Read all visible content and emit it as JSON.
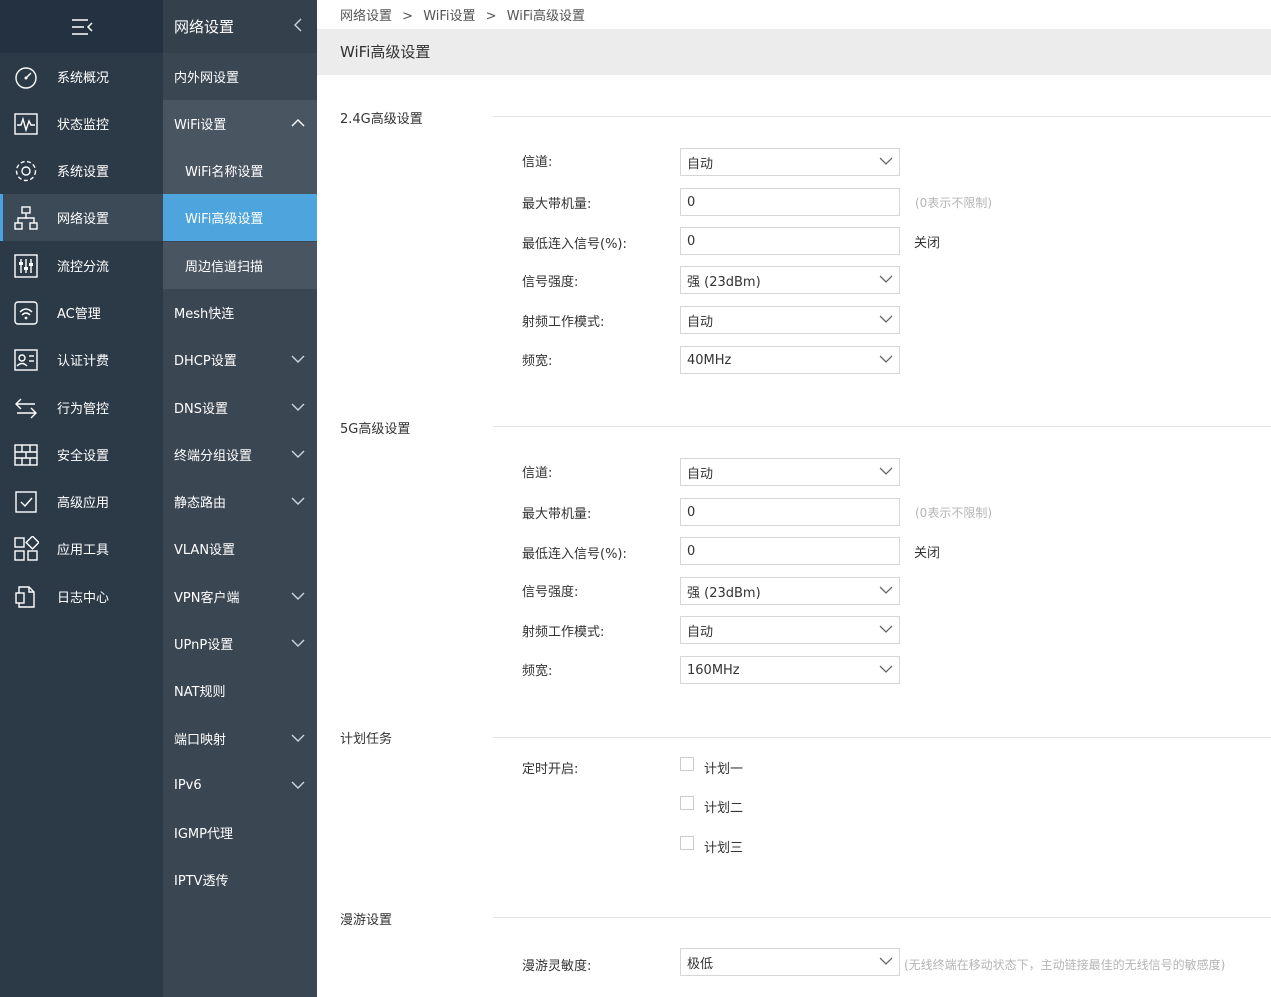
{
  "nav1": {
    "items": [
      {
        "label": "系统概况",
        "icon": "dashboard-icon"
      },
      {
        "label": "状态监控",
        "icon": "monitor-icon"
      },
      {
        "label": "系统设置",
        "icon": "gear-icon"
      },
      {
        "label": "网络设置",
        "icon": "network-icon"
      },
      {
        "label": "流控分流",
        "icon": "sliders-icon"
      },
      {
        "label": "AC管理",
        "icon": "ap-icon"
      },
      {
        "label": "认证计费",
        "icon": "id-card-icon"
      },
      {
        "label": "行为管控",
        "icon": "arrows-icon"
      },
      {
        "label": "安全设置",
        "icon": "firewall-icon"
      },
      {
        "label": "高级应用",
        "icon": "checklist-icon"
      },
      {
        "label": "应用工具",
        "icon": "apps-icon"
      },
      {
        "label": "日志中心",
        "icon": "document-icon"
      }
    ]
  },
  "nav2": {
    "title": "网络设置",
    "items": [
      {
        "label": "内外网设置"
      },
      {
        "label": "WiFi设置"
      },
      {
        "label": "WiFi名称设置"
      },
      {
        "label": "WiFi高级设置"
      },
      {
        "label": "周边信道扫描"
      },
      {
        "label": "Mesh快连"
      },
      {
        "label": "DHCP设置"
      },
      {
        "label": "DNS设置"
      },
      {
        "label": "终端分组设置"
      },
      {
        "label": "静态路由"
      },
      {
        "label": "VLAN设置"
      },
      {
        "label": "VPN客户端"
      },
      {
        "label": "UPnP设置"
      },
      {
        "label": "NAT规则"
      },
      {
        "label": "端口映射"
      },
      {
        "label": "IPv6"
      },
      {
        "label": "IGMP代理"
      },
      {
        "label": "IPTV透传"
      }
    ]
  },
  "breadcrumb": {
    "a": "网络设置",
    "sep": ">",
    "b": "WiFi设置",
    "c": "WiFi高级设置"
  },
  "page_title": "WiFi高级设置",
  "sec24": {
    "title": "2.4G高级设置",
    "channel_label": "信道:",
    "channel_value": "自动",
    "maxclients_label": "最大带机量:",
    "maxclients_value": "0",
    "maxclients_hint": "(0表示不限制)",
    "minsignal_label": "最低连入信号(%):",
    "minsignal_value": "0",
    "minsignal_state": "关闭",
    "power_label": "信号强度:",
    "power_value": "强 (23dBm)",
    "mode_label": "射频工作模式:",
    "mode_value": "自动",
    "bw_label": "频宽:",
    "bw_value": "40MHz"
  },
  "sec5": {
    "title": "5G高级设置",
    "channel_label": "信道:",
    "channel_value": "自动",
    "maxclients_label": "最大带机量:",
    "maxclients_value": "0",
    "maxclients_hint": "(0表示不限制)",
    "minsignal_label": "最低连入信号(%):",
    "minsignal_value": "0",
    "minsignal_state": "关闭",
    "power_label": "信号强度:",
    "power_value": "强 (23dBm)",
    "mode_label": "射频工作模式:",
    "mode_value": "自动",
    "bw_label": "频宽:",
    "bw_value": "160MHz"
  },
  "schedule": {
    "title": "计划任务",
    "label": "定时开启:",
    "plans": [
      "计划一",
      "计划二",
      "计划三"
    ]
  },
  "roaming": {
    "title": "漫游设置",
    "label": "漫游灵敏度:",
    "value": "极低",
    "hint": "(无线终端在移动状态下，主动链接最佳的无线信号的敏感度)"
  }
}
